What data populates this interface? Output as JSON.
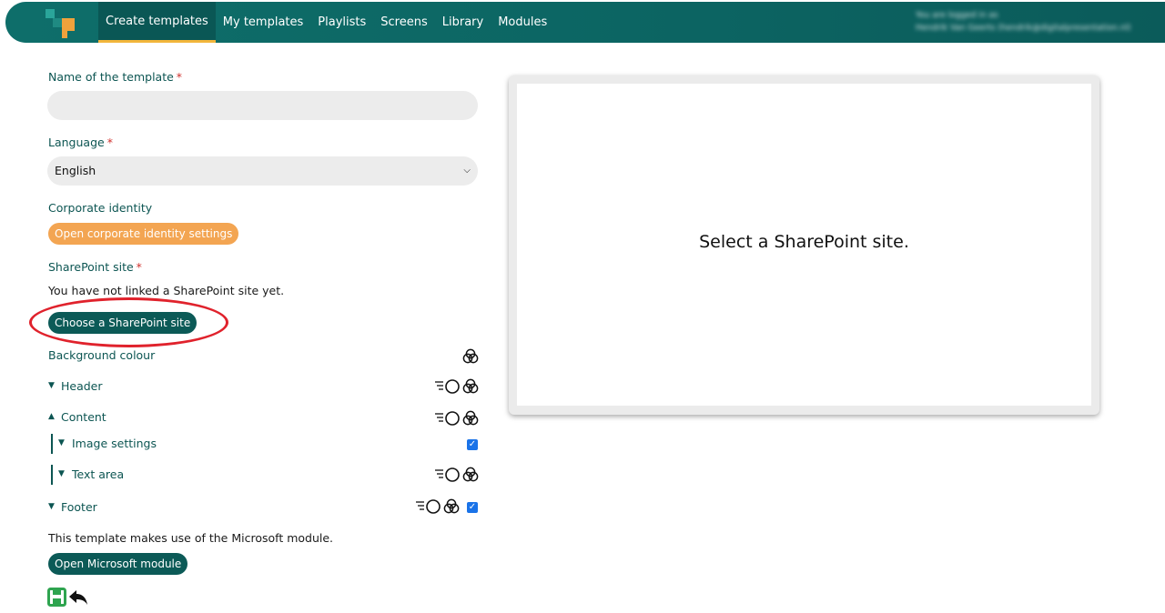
{
  "nav": {
    "items": [
      {
        "label": "Create templates",
        "active": true
      },
      {
        "label": "My templates"
      },
      {
        "label": "Playlists"
      },
      {
        "label": "Screens"
      },
      {
        "label": "Library"
      },
      {
        "label": "Modules"
      }
    ],
    "login_line1": "You are logged in as",
    "login_line2": "Hendrik Van Geerts (hendrik@digitalpresentation.nl)"
  },
  "form": {
    "name_label": "Name of the template",
    "name_value": "",
    "required_mark": "*",
    "language_label": "Language",
    "language_value": "English",
    "corporate_label": "Corporate identity",
    "corporate_button": "Open corporate identity settings",
    "sharepoint_label": "SharePoint site",
    "sharepoint_status": "You have not linked a SharePoint site yet.",
    "sharepoint_button": "Choose a SharePoint site",
    "background_label": "Background colour",
    "sections": {
      "header": "Header",
      "content": "Content",
      "image_settings": "Image settings",
      "text_area": "Text area",
      "footer": "Footer"
    },
    "checkboxes": {
      "image_settings": true,
      "footer": true
    },
    "module_note": "This template makes use of the  Microsoft module.",
    "module_button": "Open  Microsoft module"
  },
  "preview": {
    "message": "Select a SharePoint site."
  },
  "icons": {
    "circles": "color-circles-icon",
    "align": "alignment-icon",
    "save": "save-icon",
    "back": "undo-arrow-icon"
  },
  "colors": {
    "brand_teal": "#0c5a57",
    "accent_orange": "#f3a552",
    "active_underline": "#f2b63c",
    "annotation_red": "#e0222c"
  }
}
